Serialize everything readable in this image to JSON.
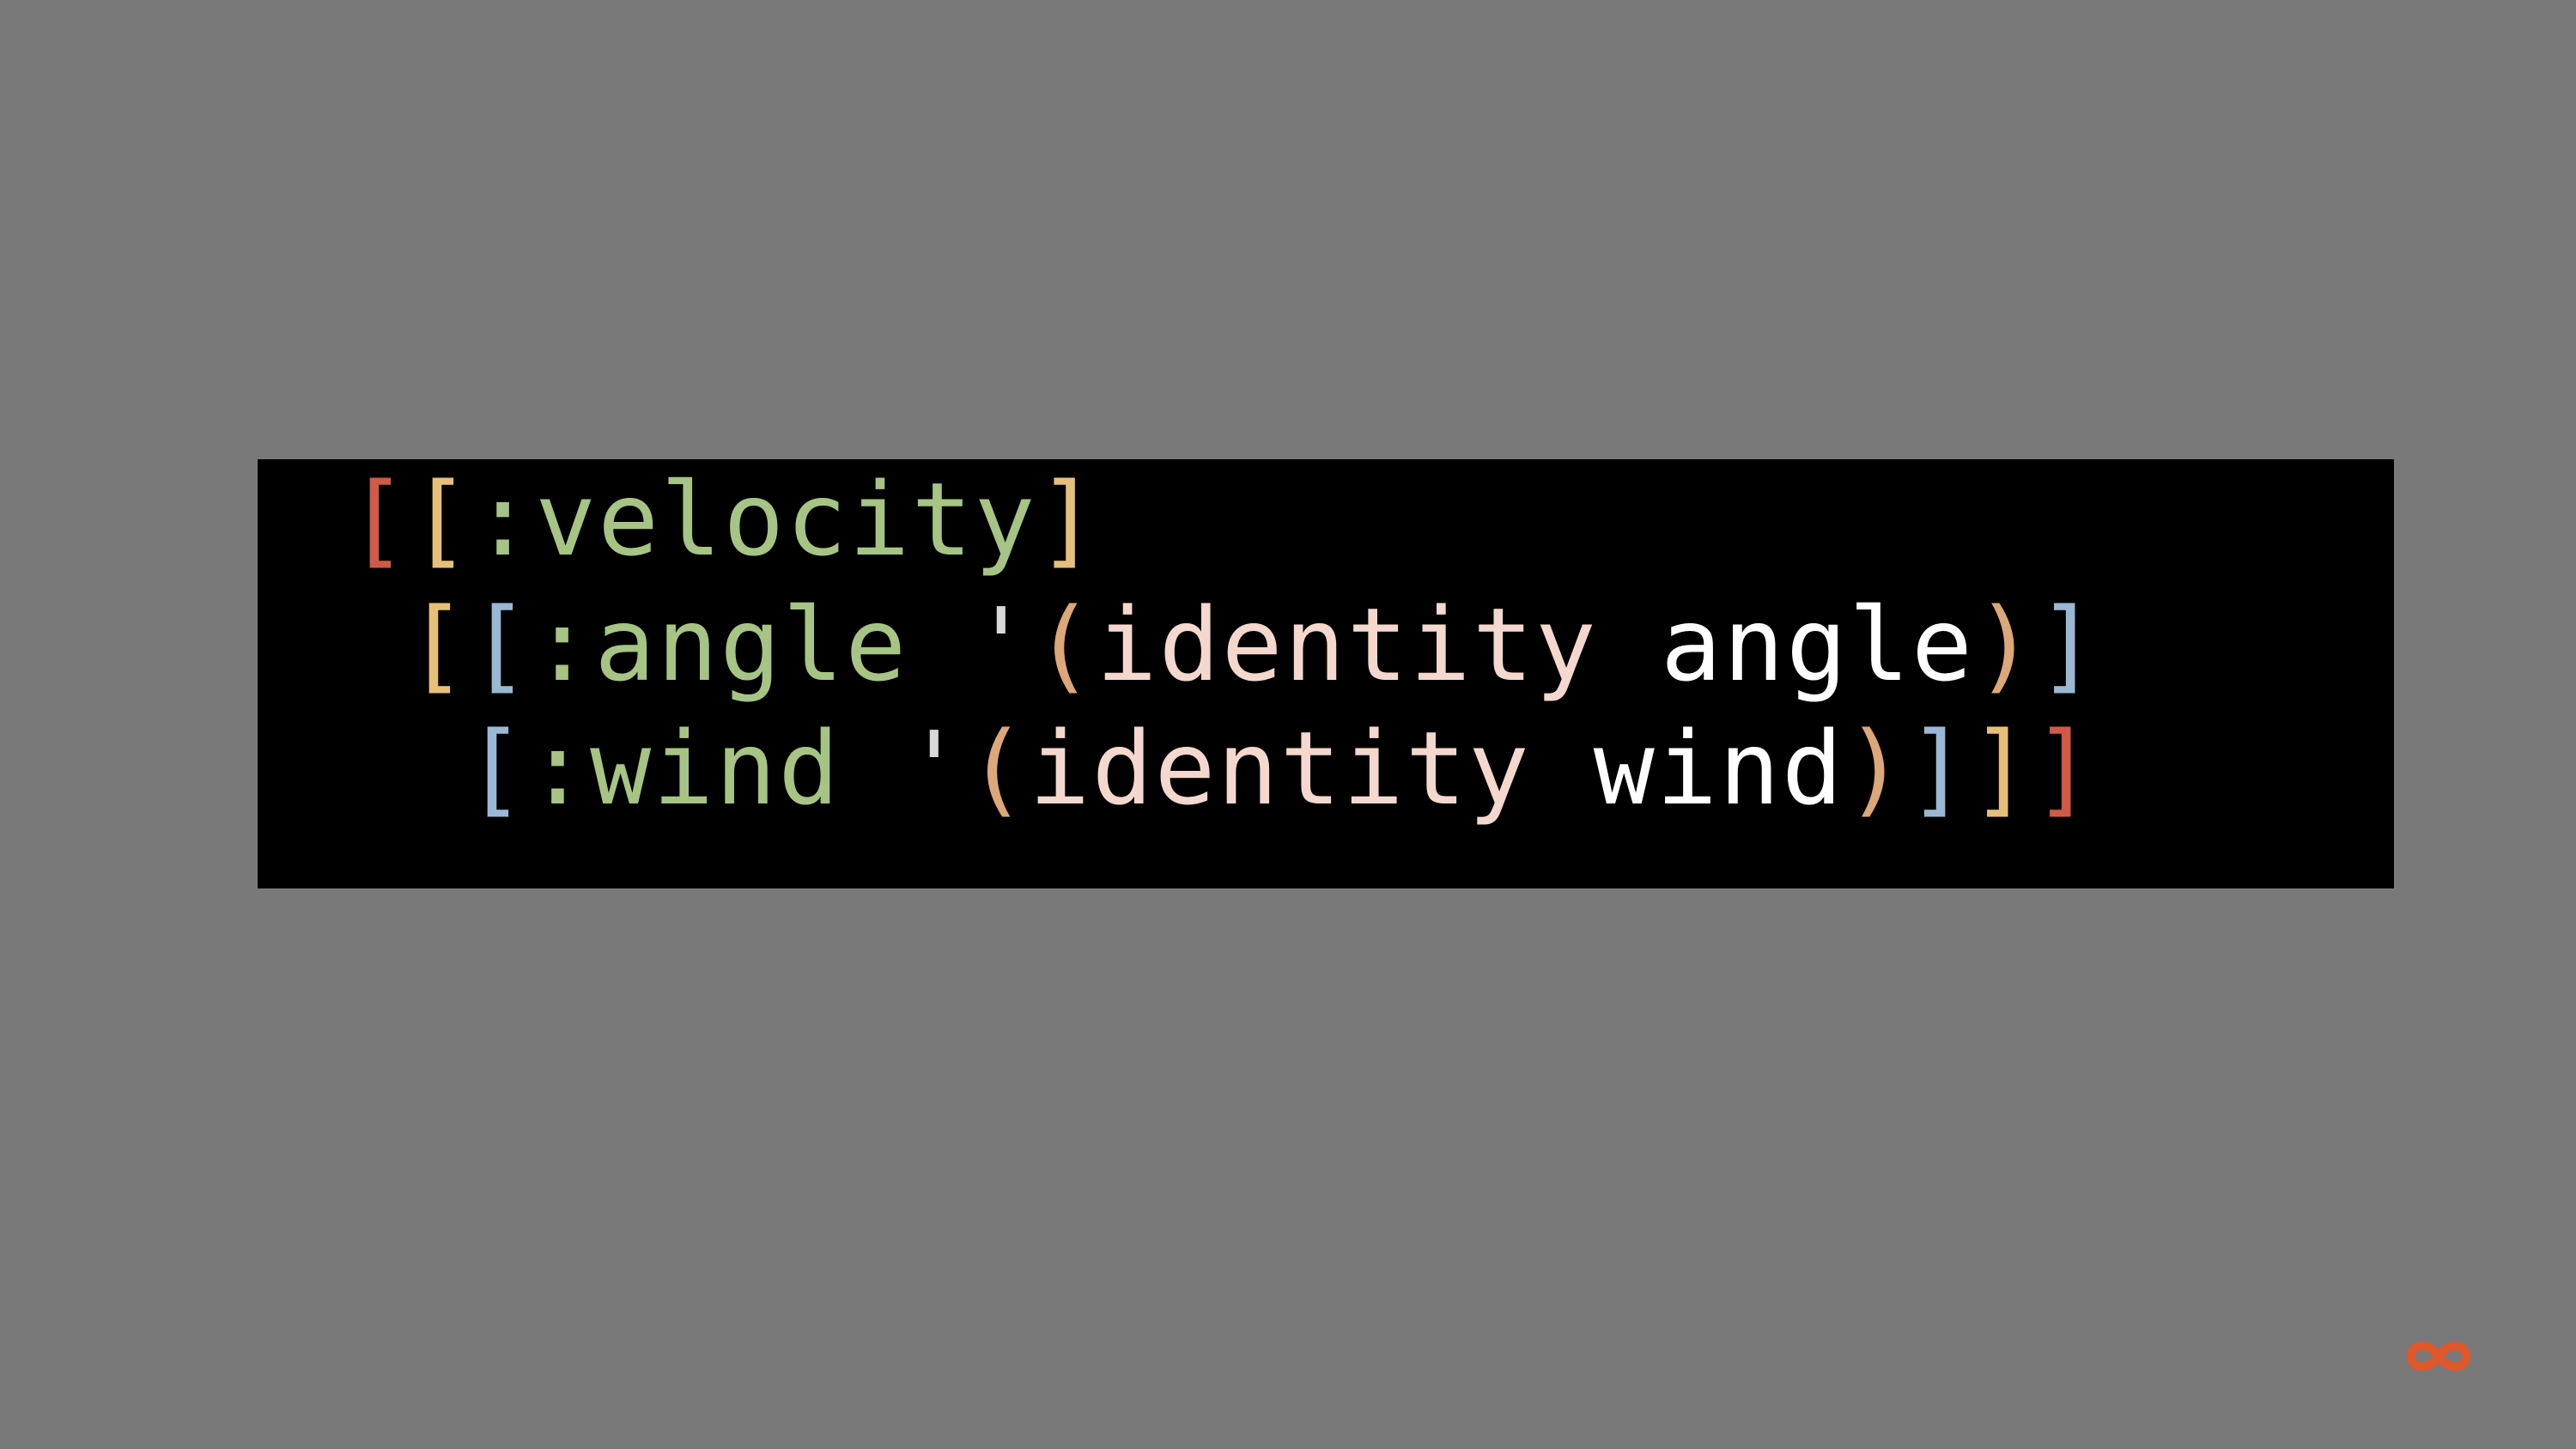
{
  "colors": {
    "background": "#797979",
    "panel": "#000000",
    "bracket_red": "#d05a45",
    "bracket_yellow": "#e6c07a",
    "bracket_blue": "#9ab8d4",
    "keyword_green": "#a6c483",
    "paren_peach": "#dca779",
    "identifier_pink": "#f4d8cd",
    "symbol_white": "#ffffff",
    "quote_gray": "#d9d9d9",
    "logo_orange": "#e0572a"
  },
  "code": {
    "lines": [
      {
        "tokens": [
          {
            "text": "[",
            "color": "#d05a45"
          },
          {
            "text": "[",
            "color": "#e6c07a"
          },
          {
            "text": ":velocity",
            "color": "#a6c483"
          },
          {
            "text": "]",
            "color": "#e6c07a"
          }
        ]
      },
      {
        "tokens": [
          {
            "text": "[",
            "color": "#e6c07a"
          },
          {
            "text": "[",
            "color": "#9ab8d4"
          },
          {
            "text": ":angle",
            "color": "#a6c483"
          },
          {
            "text": " ",
            "color": "#ffffff"
          },
          {
            "text": "'",
            "color": "#d9d9d9"
          },
          {
            "text": "(",
            "color": "#dca779"
          },
          {
            "text": "identity",
            "color": "#f4d8cd"
          },
          {
            "text": " angle",
            "color": "#ffffff"
          },
          {
            "text": ")",
            "color": "#dca779"
          },
          {
            "text": "]",
            "color": "#9ab8d4"
          }
        ]
      },
      {
        "tokens": [
          {
            "text": "[",
            "color": "#9ab8d4"
          },
          {
            "text": ":wind",
            "color": "#a6c483"
          },
          {
            "text": " ",
            "color": "#ffffff"
          },
          {
            "text": "'",
            "color": "#d9d9d9"
          },
          {
            "text": "(",
            "color": "#dca779"
          },
          {
            "text": "identity",
            "color": "#f4d8cd"
          },
          {
            "text": " wind",
            "color": "#ffffff"
          },
          {
            "text": ")",
            "color": "#dca779"
          },
          {
            "text": "]",
            "color": "#9ab8d4"
          },
          {
            "text": "]",
            "color": "#e6c07a"
          },
          {
            "text": "]",
            "color": "#d05a45"
          }
        ]
      }
    ]
  },
  "logo": {
    "icon": "infinity-logo-icon"
  }
}
